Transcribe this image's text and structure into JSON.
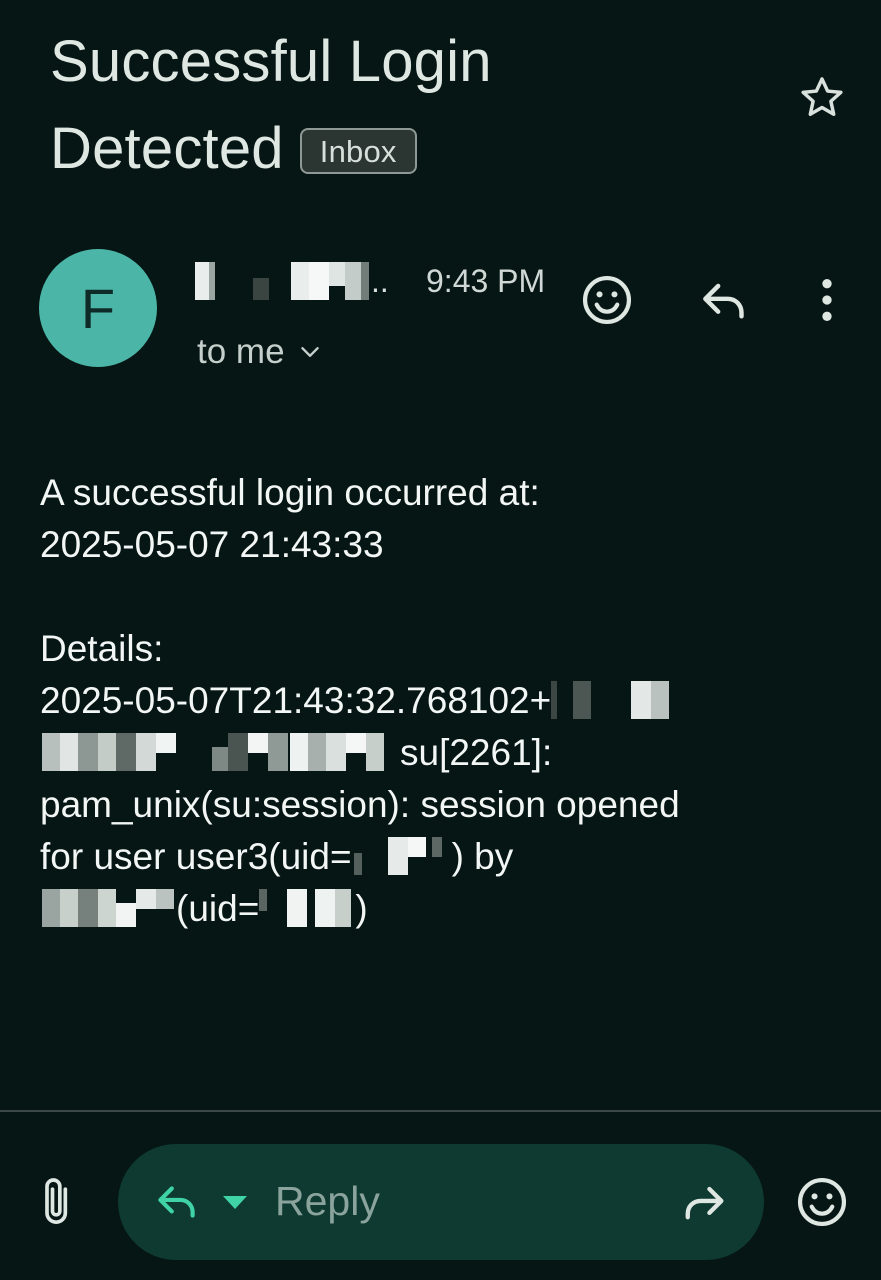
{
  "email": {
    "subject_line1": "Successful Login",
    "subject_line2": "Detected",
    "label": "Inbox",
    "sender_initial": "F",
    "sender_name_suffix": "..",
    "time": "9:43 PM",
    "recipient": "to me",
    "body": {
      "line1": "A successful login occurred at:",
      "line2": "2025-05-07 21:43:33",
      "line3": "Details:",
      "line4": "2025-05-07T21:43:32.768102+",
      "line5": "su[2261]:",
      "line6": "pam_unix(su:session): session opened",
      "line7a": "for user user3(uid=",
      "line7b": ") by",
      "line8a": "(uid=",
      "line8b": ")"
    }
  },
  "reply_bar": {
    "placeholder": "Reply"
  },
  "icons": {
    "star": "star-outline-icon",
    "emoji": "emoji-reaction-icon",
    "reply": "reply-icon",
    "more": "more-vert-icon",
    "chevron": "chevron-down-icon",
    "attach": "attachment-icon",
    "forward": "forward-icon"
  },
  "colors": {
    "background": "#061614",
    "avatar": "#4bb6a8",
    "reply_bar": "#0e3a31",
    "accent": "#3fd3a6"
  }
}
